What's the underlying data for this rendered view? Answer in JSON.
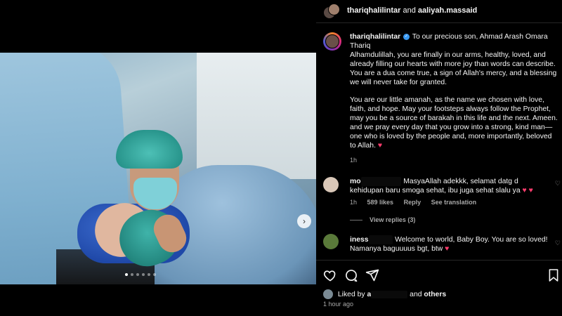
{
  "header": {
    "user1": "thariqhalilintar",
    "conj": "and",
    "user2": "aaliyah.massaid"
  },
  "caption": {
    "username": "thariqhalilintar",
    "line1": "To our precious son, Ahmad Arash Omara Thariq",
    "para1": "Alhamdulillah, you are finally in our arms, healthy, loved, and already filling our hearts with more joy than words can describe. You are a dua come true, a sign of Allah's mercy, and a blessing we will never take for granted.",
    "para2": "You are our little amanah, as the name we chosen with love, faith, and hope. May your footsteps always follow the Prophet, may you be a source of barakah in this life and the next. Ameen. and we pray every day that you grow into a strong, kind man—one who is loved by the people and, more importantly, beloved to Allah.",
    "emoji": "♥",
    "time": "1h"
  },
  "comments": [
    {
      "username_visible": "mo",
      "username_redacted": "xxxxxxxxxx",
      "text": "MasyaAllah adekkk, selamat datg d kehidupan baru smoga sehat, ibu juga sehat slalu ya",
      "emoji": "♥ ♥",
      "time": "1h",
      "likes": "589 likes",
      "reply": "Reply",
      "translate": "See translation",
      "view_replies": "View replies (3)"
    },
    {
      "username_visible": "iness",
      "username_redacted": "xxxxxx",
      "text": "Welcome to world, Baby Boy. You are so loved! Namanya baguuuus bgt, btw",
      "emoji": "♥"
    }
  ],
  "likes": {
    "prefix": "Liked by",
    "name_visible": "a",
    "name_redacted": "xxxxxxxxx",
    "and": "and",
    "others": "others"
  },
  "time_ago": "1 hour ago",
  "carousel": {
    "slides": 6,
    "active": 1
  },
  "icons": [
    "heart-icon",
    "comment-icon",
    "share-icon",
    "bookmark-icon",
    "chevron-right-icon",
    "verified-icon"
  ],
  "colors": {
    "accent": "#3897f0",
    "heart": "#ff3d6e",
    "background": "#000000",
    "muted": "#a8a8a8"
  }
}
